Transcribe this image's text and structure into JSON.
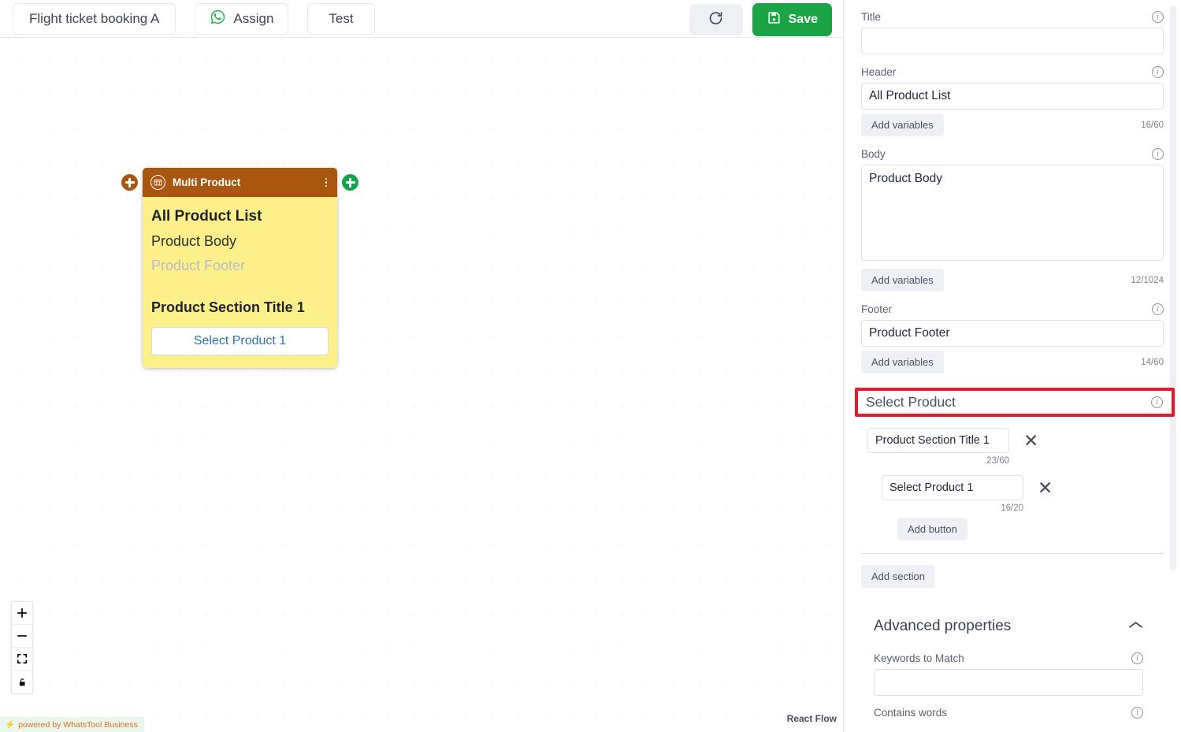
{
  "toolbar": {
    "flow_name": "Flight ticket booking A",
    "assign_label": "Assign",
    "assign_icon": "whatsapp-icon",
    "test_label": "Test",
    "refresh_icon": "refresh-icon",
    "save_label": "Save",
    "save_icon": "save-disk-icon",
    "save_color": "#1aa446"
  },
  "canvas": {
    "attribution": "powered by WhatsTool Business",
    "watermark": "React Flow",
    "zoom_controls": [
      {
        "name": "zoom-in-button",
        "icon": "plus-icon"
      },
      {
        "name": "zoom-out-button",
        "icon": "minus-icon"
      },
      {
        "name": "fit-view-button",
        "icon": "fit-view-icon"
      },
      {
        "name": "lock-button",
        "icon": "lock-icon"
      }
    ]
  },
  "node": {
    "header_title": "Multi Product",
    "header_icon": "multi-product-icon",
    "menu_icon": "kebab-menu-icon",
    "header_color": "#a85610",
    "body_color": "#fdf08a",
    "header_text": "All Product List",
    "body_text": "Product Body",
    "footer_text": "Product Footer",
    "section_title": "Product Section Title 1",
    "button_label": "Select Product 1",
    "handles": {
      "left_icon": "plus-icon",
      "right_icon": "plus-icon",
      "left_color": "#a85610",
      "right_color": "#16a34a"
    }
  },
  "panel": {
    "title": {
      "label": "Title",
      "value": "",
      "placeholder": ""
    },
    "header": {
      "label": "Header",
      "value": "All Product List",
      "add_variables": "Add variables",
      "counter": "16/60"
    },
    "body": {
      "label": "Body",
      "value": "Product Body",
      "add_variables": "Add variables",
      "counter": "12/1024"
    },
    "footer": {
      "label": "Footer",
      "value": "Product Footer",
      "add_variables": "Add variables",
      "counter": "14/60"
    },
    "select_product": {
      "title": "Select Product",
      "highlight_color": "#e8182b",
      "section_title": {
        "value": "Product Section Title 1",
        "counter": "23/60"
      },
      "button": {
        "value": "Select Product 1",
        "counter": "16/20"
      },
      "add_button_label": "Add button"
    },
    "add_section_label": "Add section",
    "advanced": {
      "title": "Advanced properties",
      "chevron_icon": "chevron-up-icon",
      "keywords_label": "Keywords to Match",
      "keywords_value": "",
      "contains_label": "Contains words"
    }
  }
}
